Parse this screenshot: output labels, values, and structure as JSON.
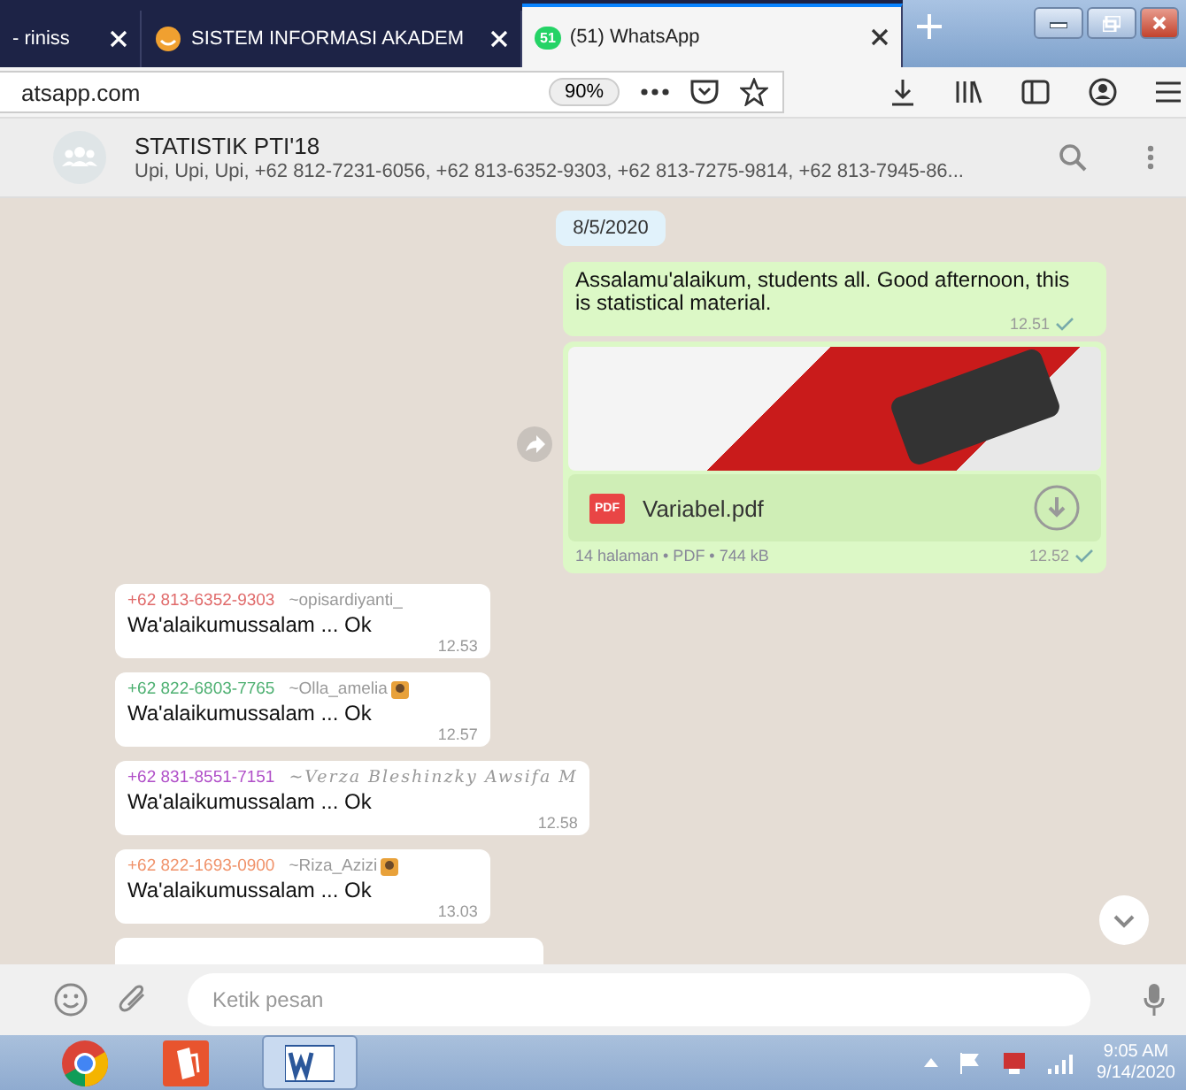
{
  "browser": {
    "tabs": [
      {
        "title": "- riniss",
        "kind": "plain",
        "selected": false
      },
      {
        "title": "SISTEM INFORMASI AKADEM",
        "kind": "akademik",
        "selected": false
      },
      {
        "title": "(51) WhatsApp",
        "kind": "whatsapp",
        "badge": "51",
        "selected": true
      }
    ],
    "address": "atsapp.com",
    "zoom": "90%"
  },
  "chat": {
    "title": "STATISTIK PTI'18",
    "participants": "Upi, Upi, Upi, +62 812-7231-6056, +62 813-6352-9303, +62 813-7275-9814, +62 813-7945-86..."
  },
  "date_chip": "8/5/2020",
  "messages": [
    {
      "kind": "outgoing_text",
      "text": "Assalamu'alaikum, students all. Good afternoon, this is statistical material.",
      "time": "12.51",
      "delivered": true
    },
    {
      "kind": "outgoing_document",
      "file_name": "Variabel.pdf",
      "file_type": "PDF",
      "meta": "14 halaman • PDF • 744 kB",
      "time": "12.52",
      "delivered": true
    },
    {
      "kind": "incoming",
      "sender_phone": "+62 813-6352-9303",
      "sender_name": "~opisardiyanti_",
      "color": "#e06a6a",
      "fancy_name": false,
      "sender_emoji": false,
      "text": "Wa'alaikumussalam ... Ok",
      "time": "12.53"
    },
    {
      "kind": "incoming",
      "sender_phone": "+62 822-6803-7765",
      "sender_name": "~Olla_amelia",
      "color": "#4caf70",
      "fancy_name": false,
      "sender_emoji": true,
      "text": "Wa'alaikumussalam ... Ok",
      "time": "12.57"
    },
    {
      "kind": "incoming",
      "sender_phone": "+62 831-8551-7151",
      "sender_name": "~Verza Bleshinzky Awsifa M",
      "color": "#b04fc8",
      "fancy_name": true,
      "sender_emoji": false,
      "text": "Wa'alaikumussalam ... Ok",
      "time": "12.58"
    },
    {
      "kind": "incoming",
      "sender_phone": "+62 822-1693-0900",
      "sender_name": "~Riza_Azizi",
      "color": "#f0926a",
      "fancy_name": false,
      "sender_emoji": true,
      "text": "Wa'alaikumussalam ... Ok",
      "time": "13.03"
    },
    {
      "kind": "incoming_cut"
    }
  ],
  "composer": {
    "placeholder": "Ketik pesan"
  },
  "taskbar": {
    "time": "9:05 AM",
    "date": "9/14/2020"
  }
}
